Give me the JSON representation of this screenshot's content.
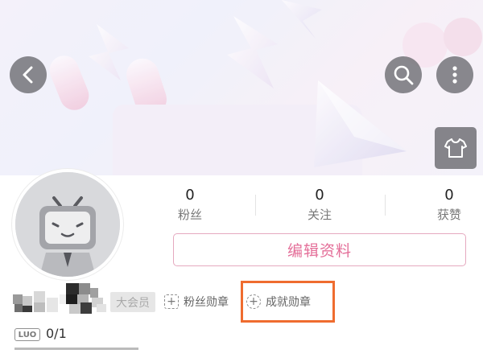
{
  "header": {
    "back_icon": "chevron-left-icon",
    "search_icon": "search-icon",
    "more_icon": "more-vertical-icon",
    "theme_icon": "t-shirt-icon"
  },
  "profile": {
    "stats": [
      {
        "value": "0",
        "label": "粉丝"
      },
      {
        "value": "0",
        "label": "关注"
      },
      {
        "value": "0",
        "label": "获赞"
      }
    ],
    "edit_button_label": "编辑资料",
    "vip_badge": "大会员",
    "medals": [
      {
        "icon": "fan-medal-icon",
        "label": "粉丝勋章"
      },
      {
        "icon": "achievement-medal-icon",
        "label": "成就勋章"
      }
    ],
    "level": {
      "badge": "LUO",
      "progress_text": "0/1",
      "progress_fraction": 0
    }
  },
  "colors": {
    "accent_pink": "#e46f99",
    "highlight_orange": "#ef6c2f"
  }
}
